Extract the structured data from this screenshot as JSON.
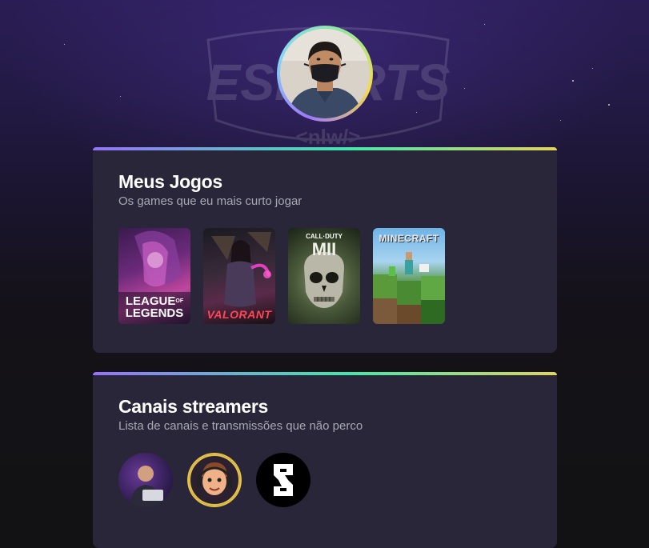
{
  "bg_logo_text": "ESPORTS",
  "bg_logo_sub": "<nlw/>",
  "profile": {
    "avatar_alt": "avatar"
  },
  "games_card": {
    "title": "Meus Jogos",
    "subtitle": "Os games que eu mais curto jogar",
    "games": [
      {
        "name": "LEAGUE OF LEGENDS",
        "line1": "LEAGUE",
        "line2": "LEGENDS",
        "of": "OF"
      },
      {
        "name": "VALORANT"
      },
      {
        "name": "CALL OF DUTY MWII",
        "top": "CALL·DUTY",
        "big": "MII"
      },
      {
        "name": "MINECRAFT"
      }
    ]
  },
  "streams_card": {
    "title": "Canais streamers",
    "subtitle": "Lista de canais e transmissões que não perco"
  },
  "colors": {
    "card_bg": "#29263a",
    "accent_purple": "#9572fc",
    "accent_green": "#43e7ad",
    "accent_yellow": "#e2d45c",
    "subtitle": "#a8a8b3"
  }
}
